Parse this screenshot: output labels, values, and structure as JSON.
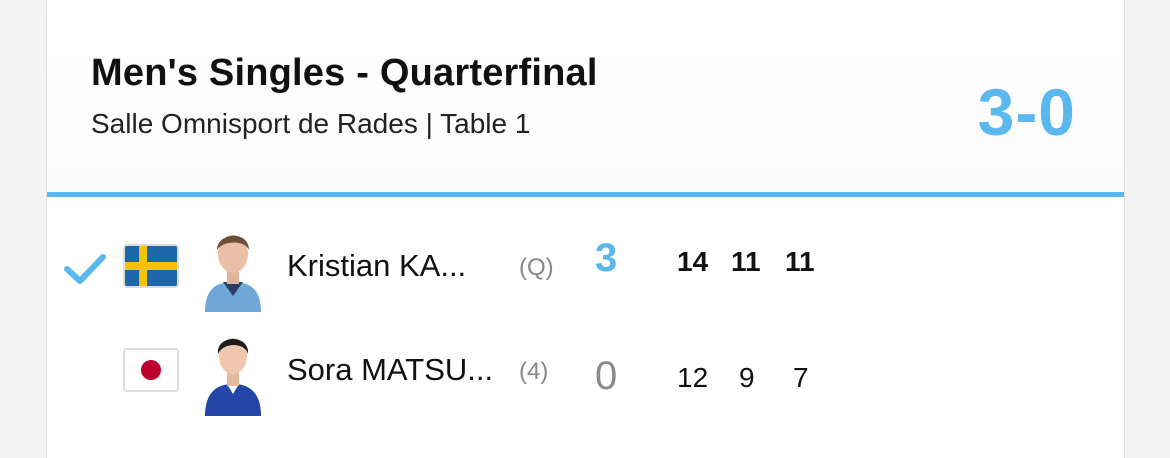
{
  "match": {
    "title": "Men's Singles - Quarterfinal",
    "venue": "Salle Omnisport de Rades | Table 1",
    "score": "3-0"
  },
  "players": [
    {
      "name": "Kristian KA...",
      "seed": "(Q)",
      "games": "3",
      "sets": [
        "14",
        "11",
        "11"
      ],
      "winner": true,
      "flag_icon": "sweden-flag-icon"
    },
    {
      "name": "Sora MATSU...",
      "seed": "(4)",
      "games": "0",
      "sets": [
        "12",
        "9",
        "7"
      ],
      "winner": false,
      "flag_icon": "japan-flag-icon"
    }
  ],
  "colors": {
    "accent": "#5bb8ee",
    "sweden_blue": "#1f67ad",
    "sweden_yellow": "#f4c400",
    "japan_red": "#bc002d"
  }
}
